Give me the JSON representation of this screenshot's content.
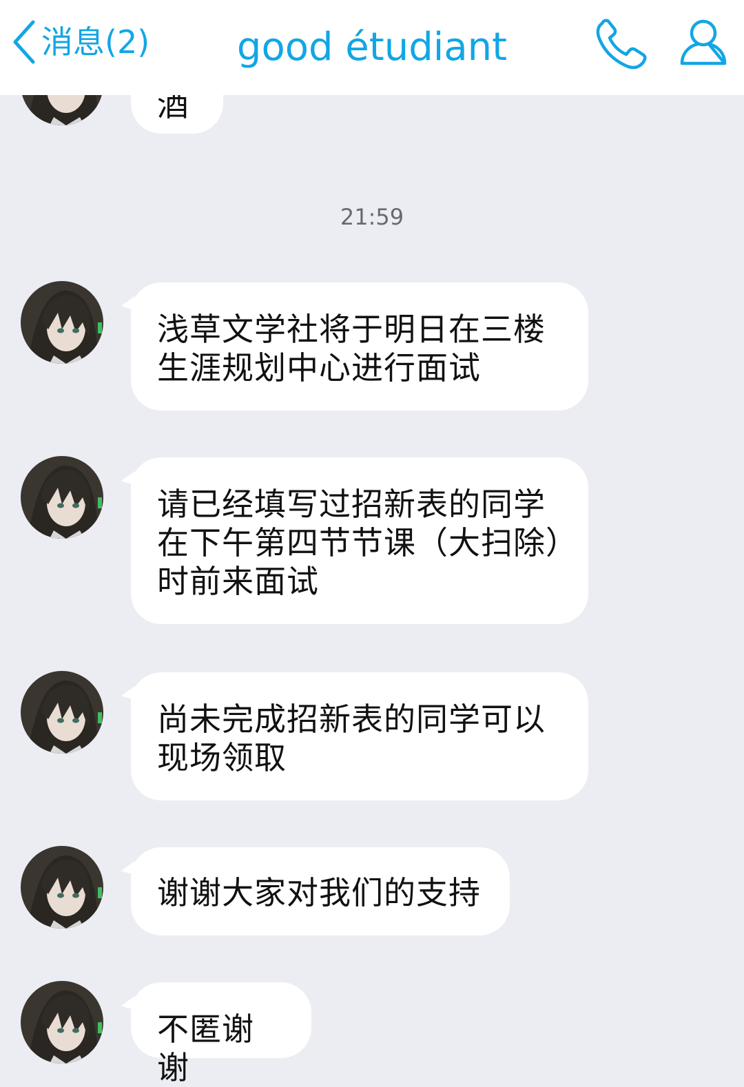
{
  "header": {
    "back_label": "消息(2)",
    "title": "good étudiant",
    "accent_color": "#12a6e4",
    "icons": [
      "back-chevron-icon",
      "phone-icon",
      "profile-icon"
    ]
  },
  "chat": {
    "timestamp": "21:59",
    "messages": [
      {
        "text": "酒"
      },
      {
        "text": "浅草文学社将于明日在三楼生涯规划中心进行面试"
      },
      {
        "text": "请已经填写过招新表的同学在下午第四节节课（大扫除）时前来面试"
      },
      {
        "text": "尚未完成招新表的同学可以现场领取"
      },
      {
        "text": "谢谢大家对我们的支持"
      },
      {
        "text": "不匿谢谢"
      }
    ]
  }
}
